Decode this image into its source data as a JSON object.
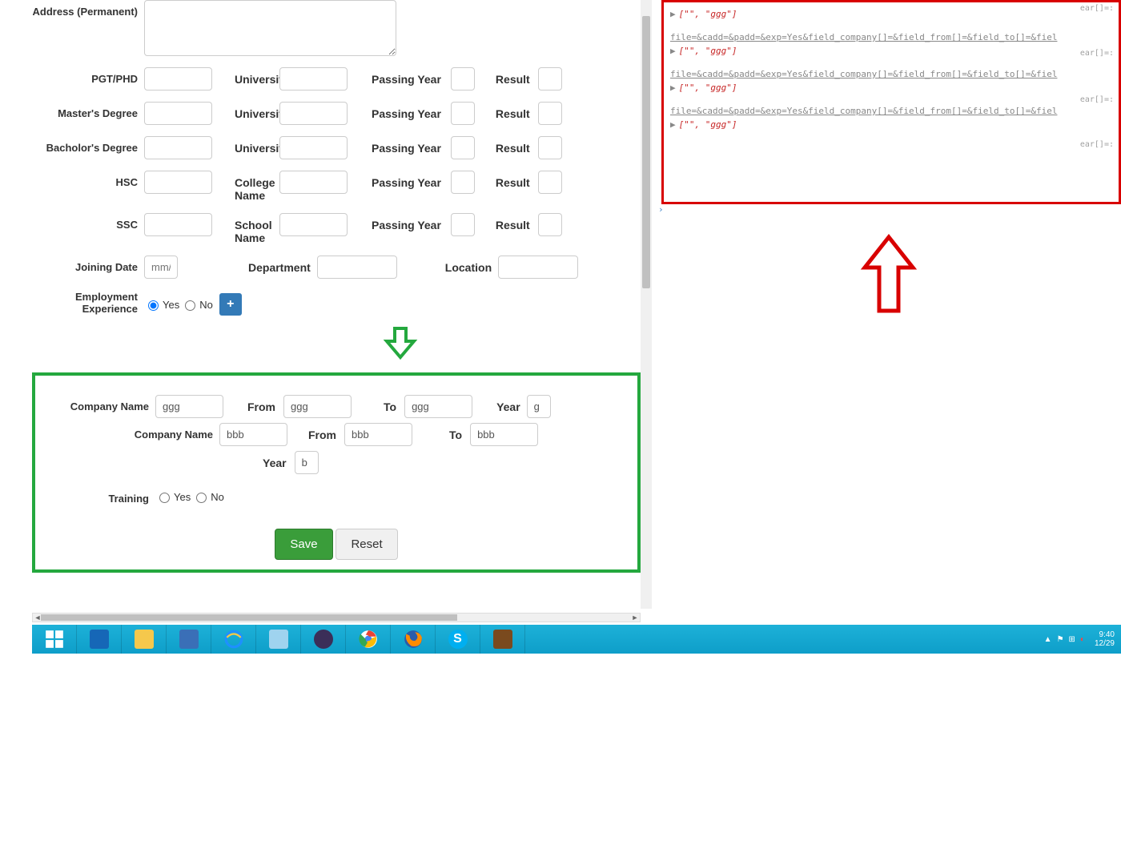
{
  "form": {
    "address_label": "Address (Permanent)",
    "education": [
      {
        "degreeLabel": "PGT/PHD",
        "instLabel": "University",
        "instVal": "",
        "passLabel": "Passing Year",
        "resultLabel": "Result"
      },
      {
        "degreeLabel": "Master's Degree",
        "instLabel": "University",
        "instVal": "",
        "passLabel": "Passing Year",
        "resultLabel": "Result"
      },
      {
        "degreeLabel": "Bacholor's Degree",
        "instLabel": "University",
        "instVal": "",
        "passLabel": "Passing Year",
        "resultLabel": "Result"
      },
      {
        "degreeLabel": "HSC",
        "instLabel": "College Name",
        "instVal": "",
        "passLabel": "Passing Year",
        "resultLabel": "Result"
      },
      {
        "degreeLabel": "SSC",
        "instLabel": "School Name",
        "instVal": "",
        "passLabel": "Passing Year",
        "resultLabel": "Result"
      }
    ],
    "joining_label": "Joining Date",
    "joining_placeholder": "mm/dd/yyyy",
    "department_label": "Department",
    "location_label": "Location",
    "employment_label": "Employment Experience",
    "yes": "Yes",
    "no": "No",
    "exp": [
      {
        "companyLabel": "Company Name",
        "companyVal": "ggg",
        "fromLabel": "From",
        "fromVal": "ggg",
        "toLabel": "To",
        "toVal": "ggg",
        "yearLabel": "Year",
        "yearVal": "g"
      },
      {
        "companyLabel": "Company Name",
        "companyVal": "bbb",
        "fromLabel": "From",
        "fromVal": "bbb",
        "toLabel": "To",
        "toVal": "bbb",
        "yearLabel": "Year",
        "yearVal": "b"
      }
    ],
    "training_label": "Training",
    "save": "Save",
    "reset": "Reset"
  },
  "console": {
    "items": [
      {
        "data": "[\"\", \"ggg\"]",
        "url": "file=&cadd=&padd=&exp=Yes&field_company[]=&field_from[]=&field_to[]=&fiel",
        "tail": "ear[]=:"
      },
      {
        "data": "[\"\", \"ggg\"]",
        "url": "file=&cadd=&padd=&exp=Yes&field_company[]=&field_from[]=&field_to[]=&fiel",
        "tail": "ear[]=:"
      },
      {
        "data": "[\"\", \"ggg\"]",
        "url": "file=&cadd=&padd=&exp=Yes&field_company[]=&field_from[]=&field_to[]=&fiel",
        "tail": "ear[]=:"
      },
      {
        "data": "[\"\", \"ggg\"]",
        "url": "",
        "tail": ""
      }
    ]
  },
  "taskbar": {
    "time": "9:40",
    "date": "12/29",
    "icons": [
      "start",
      "powershell",
      "explorer",
      "vmware",
      "ie",
      "notepad",
      "eclipse",
      "chrome",
      "firefox",
      "skype",
      "javaee"
    ]
  }
}
